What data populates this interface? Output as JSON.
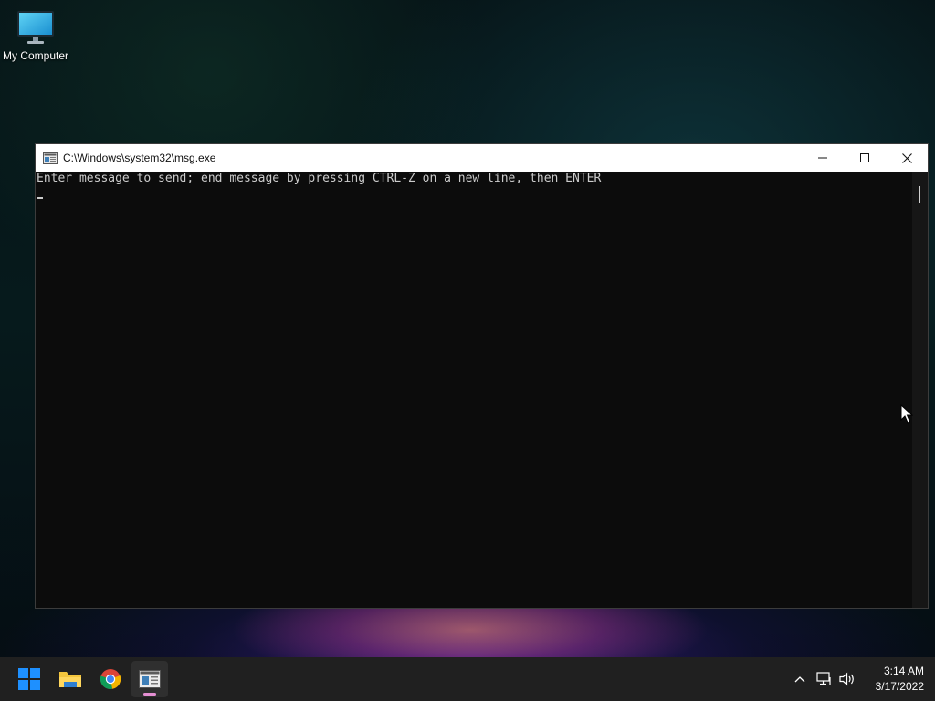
{
  "desktop": {
    "icons": [
      {
        "label": "My Computer",
        "icon": "monitor-icon"
      }
    ]
  },
  "window": {
    "title": "C:\\Windows\\system32\\msg.exe",
    "icon": "console-app-icon",
    "controls": {
      "minimize": "minimize-icon",
      "maximize": "maximize-icon",
      "close": "close-icon"
    },
    "console": {
      "lines": [
        "Enter message to send; end message by pressing CTRL-Z on a new line, then ENTER"
      ],
      "input_value": ""
    }
  },
  "taskbar": {
    "apps": [
      {
        "name": "Start",
        "icon": "windows-start-icon",
        "active": false
      },
      {
        "name": "File Explorer",
        "icon": "folder-icon",
        "active": false
      },
      {
        "name": "Google Chrome",
        "icon": "chrome-icon",
        "active": false
      },
      {
        "name": "msg.exe",
        "icon": "console-app-icon",
        "active": true
      }
    ],
    "tray": {
      "icons": [
        "chevron-up-icon",
        "network-icon",
        "speaker-icon"
      ],
      "time": "3:14 AM",
      "date": "3/17/2022"
    }
  },
  "colors": {
    "console_bg": "#0c0c0c",
    "console_text": "#cccccc",
    "taskbar_bg": "#202020",
    "active_indicator": "#e58fd3",
    "start_blue": "#1e90ff"
  }
}
